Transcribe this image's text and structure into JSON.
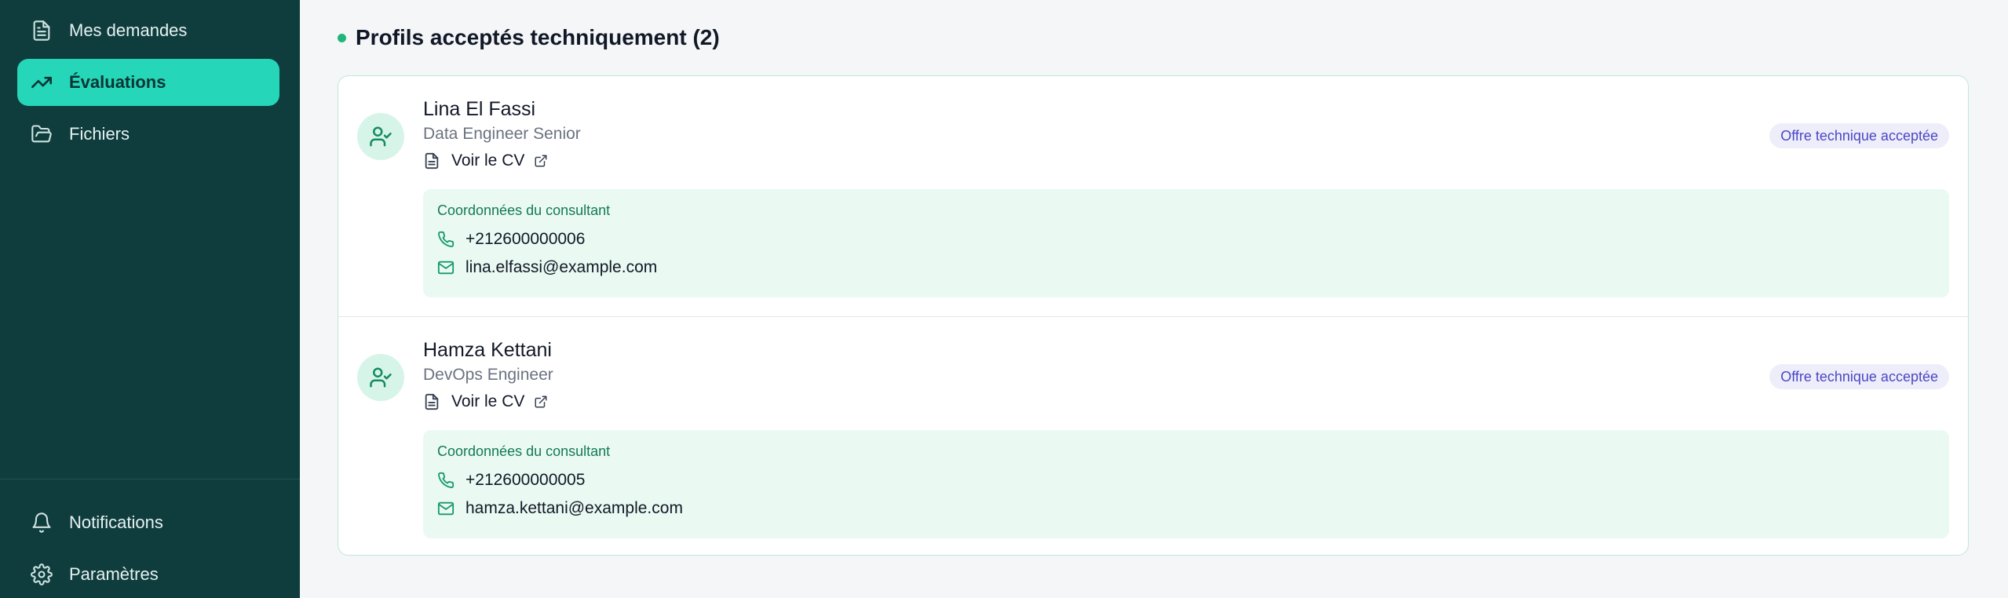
{
  "sidebar": {
    "items": [
      {
        "label": "Mes demandes",
        "icon": "file-text-icon"
      },
      {
        "label": "Évaluations",
        "icon": "trending-up-icon",
        "active": true
      },
      {
        "label": "Fichiers",
        "icon": "folder-open-icon"
      }
    ],
    "bottom_items": [
      {
        "label": "Notifications",
        "icon": "bell-icon"
      },
      {
        "label": "Paramètres",
        "icon": "settings-icon"
      }
    ]
  },
  "main": {
    "section_title": "Profils acceptés techniquement (2)",
    "profiles": [
      {
        "name": "Lina El Fassi",
        "role": "Data Engineer Senior",
        "cv_label": "Voir le CV",
        "badge": "Offre technique acceptée",
        "contact_title": "Coordonnées du consultant",
        "phone": "+212600000006",
        "email": "lina.elfassi@example.com"
      },
      {
        "name": "Hamza Kettani",
        "role": "DevOps Engineer",
        "cv_label": "Voir le CV",
        "badge": "Offre technique acceptée",
        "contact_title": "Coordonnées du consultant",
        "phone": "+212600000005",
        "email": "hamza.kettani@example.com"
      }
    ]
  },
  "colors": {
    "sidebar_bg": "#0f3d3e",
    "active_bg": "#25d6b9",
    "accent_green": "#1fb67e",
    "badge_bg": "#eeeefb",
    "badge_text": "#4b47c4"
  }
}
